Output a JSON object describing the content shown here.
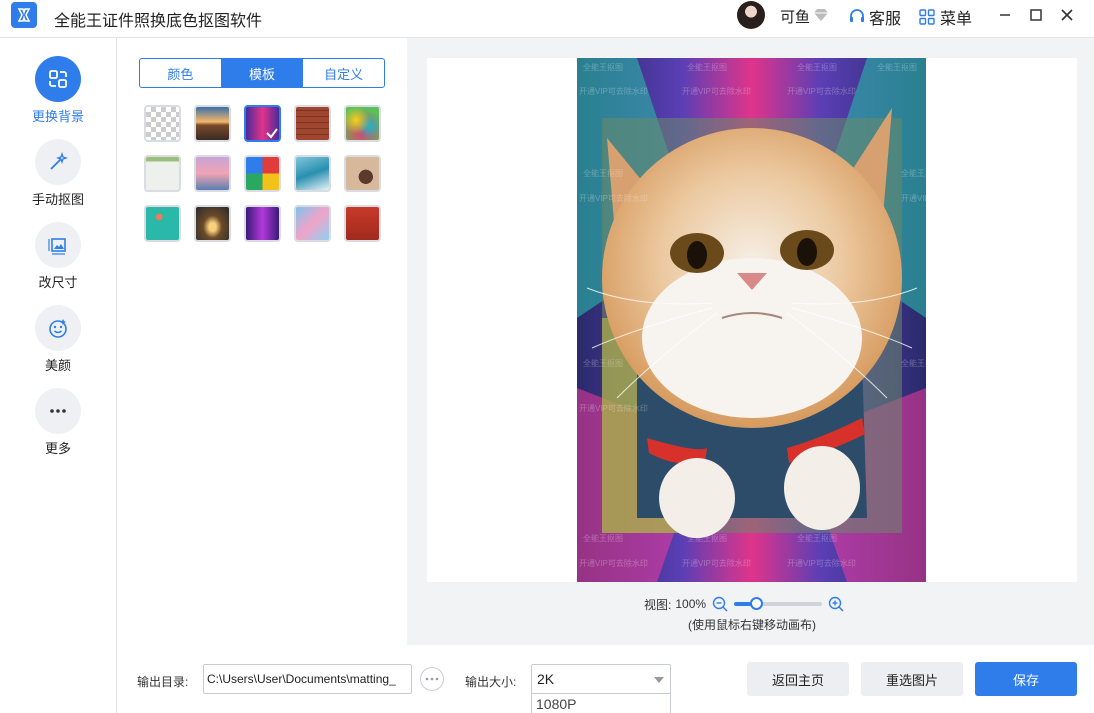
{
  "app": {
    "title": "全能王证件照换底色抠图软件",
    "username": "可鱼",
    "service_label": "客服",
    "menu_label": "菜单",
    "accent_color": "#2f7dea"
  },
  "nav": {
    "items": [
      {
        "label": "更换背景",
        "icon": "swap-background-icon",
        "active": true
      },
      {
        "label": "手动抠图",
        "icon": "magic-wand-icon",
        "active": false
      },
      {
        "label": "改尺寸",
        "icon": "image-resize-icon",
        "active": false
      },
      {
        "label": "美颜",
        "icon": "smile-face-icon",
        "active": false
      },
      {
        "label": "更多",
        "icon": "more-dots-icon",
        "active": false
      }
    ]
  },
  "panel": {
    "tabs": [
      {
        "label": "颜色",
        "active": false
      },
      {
        "label": "模板",
        "active": true
      },
      {
        "label": "自定义",
        "active": false
      }
    ],
    "templates": [
      {
        "name": "transparent",
        "selected": false
      },
      {
        "name": "road-sunset",
        "selected": false
      },
      {
        "name": "neon-tunnel",
        "selected": true
      },
      {
        "name": "brick-wall",
        "selected": false
      },
      {
        "name": "color-smoke",
        "selected": false
      },
      {
        "name": "white-wall",
        "selected": false
      },
      {
        "name": "pink-sky",
        "selected": false
      },
      {
        "name": "color-blocks",
        "selected": false
      },
      {
        "name": "ocean-waves",
        "selected": false
      },
      {
        "name": "beige-shapes",
        "selected": false
      },
      {
        "name": "teal-flower",
        "selected": false
      },
      {
        "name": "forest-path",
        "selected": false
      },
      {
        "name": "purple-neon",
        "selected": false
      },
      {
        "name": "blue-watercolor",
        "selected": false
      },
      {
        "name": "red-door",
        "selected": false
      }
    ]
  },
  "preview": {
    "watermark_1": "全能王抠图",
    "watermark_2": "开通VIP可去除水印",
    "view_label": "视图:",
    "zoom_value": "100%",
    "zoom_level": 0.25,
    "hint": "(使用鼠标右键移动画布)"
  },
  "bottom": {
    "output_dir_label": "输出目录:",
    "output_dir_value": "C:\\Users\\User\\Documents\\matting_",
    "output_size_label": "输出大小:",
    "output_size_value": "2K",
    "dropdown_option": "1080P",
    "back_home_label": "返回主页",
    "reselect_label": "重选图片",
    "save_label": "保存"
  }
}
